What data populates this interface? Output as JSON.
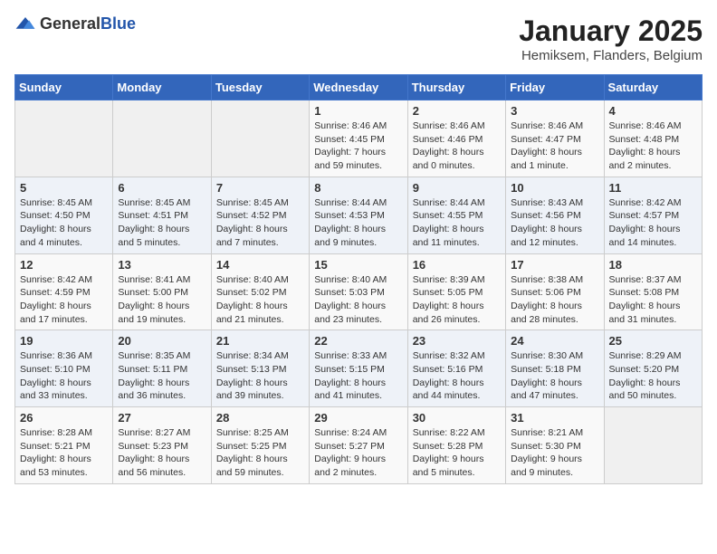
{
  "logo": {
    "general": "General",
    "blue": "Blue"
  },
  "title": "January 2025",
  "location": "Hemiksem, Flanders, Belgium",
  "days_header": [
    "Sunday",
    "Monday",
    "Tuesday",
    "Wednesday",
    "Thursday",
    "Friday",
    "Saturday"
  ],
  "weeks": [
    [
      {
        "day": "",
        "info": ""
      },
      {
        "day": "",
        "info": ""
      },
      {
        "day": "",
        "info": ""
      },
      {
        "day": "1",
        "info": "Sunrise: 8:46 AM\nSunset: 4:45 PM\nDaylight: 7 hours and 59 minutes."
      },
      {
        "day": "2",
        "info": "Sunrise: 8:46 AM\nSunset: 4:46 PM\nDaylight: 8 hours and 0 minutes."
      },
      {
        "day": "3",
        "info": "Sunrise: 8:46 AM\nSunset: 4:47 PM\nDaylight: 8 hours and 1 minute."
      },
      {
        "day": "4",
        "info": "Sunrise: 8:46 AM\nSunset: 4:48 PM\nDaylight: 8 hours and 2 minutes."
      }
    ],
    [
      {
        "day": "5",
        "info": "Sunrise: 8:45 AM\nSunset: 4:50 PM\nDaylight: 8 hours and 4 minutes."
      },
      {
        "day": "6",
        "info": "Sunrise: 8:45 AM\nSunset: 4:51 PM\nDaylight: 8 hours and 5 minutes."
      },
      {
        "day": "7",
        "info": "Sunrise: 8:45 AM\nSunset: 4:52 PM\nDaylight: 8 hours and 7 minutes."
      },
      {
        "day": "8",
        "info": "Sunrise: 8:44 AM\nSunset: 4:53 PM\nDaylight: 8 hours and 9 minutes."
      },
      {
        "day": "9",
        "info": "Sunrise: 8:44 AM\nSunset: 4:55 PM\nDaylight: 8 hours and 11 minutes."
      },
      {
        "day": "10",
        "info": "Sunrise: 8:43 AM\nSunset: 4:56 PM\nDaylight: 8 hours and 12 minutes."
      },
      {
        "day": "11",
        "info": "Sunrise: 8:42 AM\nSunset: 4:57 PM\nDaylight: 8 hours and 14 minutes."
      }
    ],
    [
      {
        "day": "12",
        "info": "Sunrise: 8:42 AM\nSunset: 4:59 PM\nDaylight: 8 hours and 17 minutes."
      },
      {
        "day": "13",
        "info": "Sunrise: 8:41 AM\nSunset: 5:00 PM\nDaylight: 8 hours and 19 minutes."
      },
      {
        "day": "14",
        "info": "Sunrise: 8:40 AM\nSunset: 5:02 PM\nDaylight: 8 hours and 21 minutes."
      },
      {
        "day": "15",
        "info": "Sunrise: 8:40 AM\nSunset: 5:03 PM\nDaylight: 8 hours and 23 minutes."
      },
      {
        "day": "16",
        "info": "Sunrise: 8:39 AM\nSunset: 5:05 PM\nDaylight: 8 hours and 26 minutes."
      },
      {
        "day": "17",
        "info": "Sunrise: 8:38 AM\nSunset: 5:06 PM\nDaylight: 8 hours and 28 minutes."
      },
      {
        "day": "18",
        "info": "Sunrise: 8:37 AM\nSunset: 5:08 PM\nDaylight: 8 hours and 31 minutes."
      }
    ],
    [
      {
        "day": "19",
        "info": "Sunrise: 8:36 AM\nSunset: 5:10 PM\nDaylight: 8 hours and 33 minutes."
      },
      {
        "day": "20",
        "info": "Sunrise: 8:35 AM\nSunset: 5:11 PM\nDaylight: 8 hours and 36 minutes."
      },
      {
        "day": "21",
        "info": "Sunrise: 8:34 AM\nSunset: 5:13 PM\nDaylight: 8 hours and 39 minutes."
      },
      {
        "day": "22",
        "info": "Sunrise: 8:33 AM\nSunset: 5:15 PM\nDaylight: 8 hours and 41 minutes."
      },
      {
        "day": "23",
        "info": "Sunrise: 8:32 AM\nSunset: 5:16 PM\nDaylight: 8 hours and 44 minutes."
      },
      {
        "day": "24",
        "info": "Sunrise: 8:30 AM\nSunset: 5:18 PM\nDaylight: 8 hours and 47 minutes."
      },
      {
        "day": "25",
        "info": "Sunrise: 8:29 AM\nSunset: 5:20 PM\nDaylight: 8 hours and 50 minutes."
      }
    ],
    [
      {
        "day": "26",
        "info": "Sunrise: 8:28 AM\nSunset: 5:21 PM\nDaylight: 8 hours and 53 minutes."
      },
      {
        "day": "27",
        "info": "Sunrise: 8:27 AM\nSunset: 5:23 PM\nDaylight: 8 hours and 56 minutes."
      },
      {
        "day": "28",
        "info": "Sunrise: 8:25 AM\nSunset: 5:25 PM\nDaylight: 8 hours and 59 minutes."
      },
      {
        "day": "29",
        "info": "Sunrise: 8:24 AM\nSunset: 5:27 PM\nDaylight: 9 hours and 2 minutes."
      },
      {
        "day": "30",
        "info": "Sunrise: 8:22 AM\nSunset: 5:28 PM\nDaylight: 9 hours and 5 minutes."
      },
      {
        "day": "31",
        "info": "Sunrise: 8:21 AM\nSunset: 5:30 PM\nDaylight: 9 hours and 9 minutes."
      },
      {
        "day": "",
        "info": ""
      }
    ]
  ]
}
